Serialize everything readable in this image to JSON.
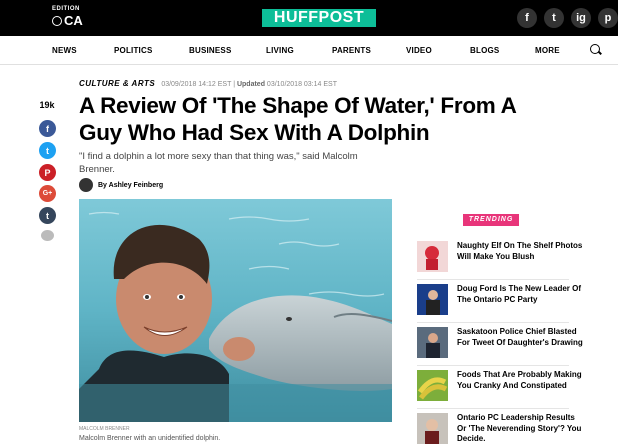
{
  "header": {
    "edition_label": "EDITION",
    "edition_value": "CA",
    "logo": "HUFFPOST",
    "social": [
      "f",
      "t",
      "ig",
      "p"
    ]
  },
  "nav": {
    "items": [
      "NEWS",
      "POLITICS",
      "BUSINESS",
      "LIVING",
      "PARENTS",
      "VIDEO",
      "BLOGS",
      "MORE"
    ]
  },
  "article": {
    "section": "CULTURE & ARTS",
    "published": "03/09/2018 14:12 EST",
    "updated_label": "Updated",
    "updated": "03/10/2018 03:14 EST",
    "headline": "A Review Of 'The Shape Of Water,' From A Guy Who Had Sex With A Dolphin",
    "dek": "\"I find a dolphin a lot more sexy than that thing was,\" said Malcolm Brenner.",
    "byline": "By Ashley Feinberg",
    "photo_credit": "MALCOLM BRENNER",
    "caption": "Malcolm Brenner with an unidentified dolphin."
  },
  "share": {
    "count": "19k",
    "buttons": [
      {
        "icon": "facebook-icon",
        "glyph": "f",
        "color": "#3b5998"
      },
      {
        "icon": "twitter-icon",
        "glyph": "t",
        "color": "#1da1f2"
      },
      {
        "icon": "pinterest-icon",
        "glyph": "P",
        "color": "#cb2027"
      },
      {
        "icon": "googleplus-icon",
        "glyph": "G+",
        "color": "#dd4b39"
      },
      {
        "icon": "tumblr-icon",
        "glyph": "t",
        "color": "#35465c"
      },
      {
        "icon": "comment-icon",
        "glyph": "",
        "color": "#bbbbbb"
      }
    ]
  },
  "trending": {
    "label": "TRENDING",
    "items": [
      {
        "title": "Naughty Elf On The Shelf Photos Will Make You Blush"
      },
      {
        "title": "Doug Ford Is The New Leader Of The Ontario PC Party"
      },
      {
        "title": "Saskatoon Police Chief Blasted For Tweet Of Daughter's Drawing"
      },
      {
        "title": "Foods That Are Probably Making You Cranky And Constipated"
      },
      {
        "title": "Ontario PC Leadership Results Or 'The Neverending Story'? You Decide."
      }
    ]
  },
  "colors": {
    "brand": "#0dbe98",
    "trending": "#e8357a"
  }
}
